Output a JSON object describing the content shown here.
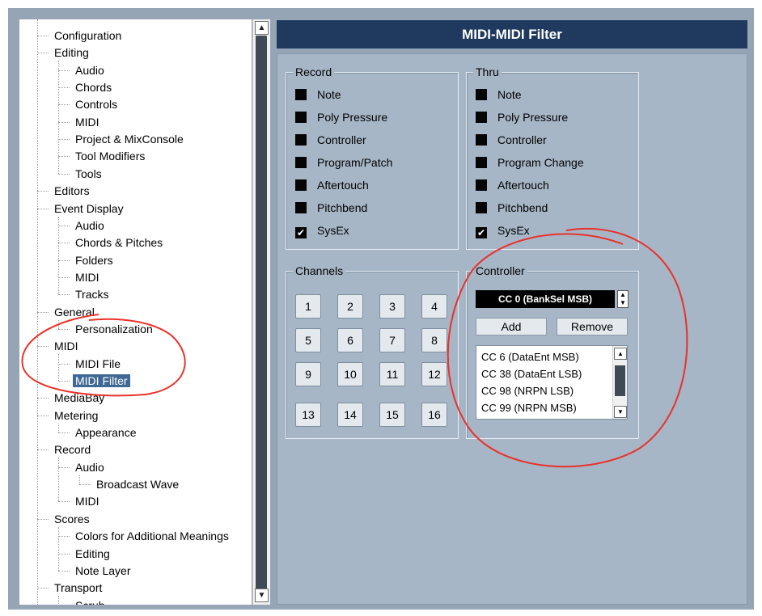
{
  "tree": {
    "items": [
      {
        "label": "Configuration",
        "level": 0
      },
      {
        "label": "Editing",
        "level": 0
      },
      {
        "label": "Audio",
        "level": 1
      },
      {
        "label": "Chords",
        "level": 1
      },
      {
        "label": "Controls",
        "level": 1
      },
      {
        "label": "MIDI",
        "level": 1
      },
      {
        "label": "Project & MixConsole",
        "level": 1
      },
      {
        "label": "Tool Modifiers",
        "level": 1
      },
      {
        "label": "Tools",
        "level": 1
      },
      {
        "label": "Editors",
        "level": 0
      },
      {
        "label": "Event Display",
        "level": 0
      },
      {
        "label": "Audio",
        "level": 1
      },
      {
        "label": "Chords & Pitches",
        "level": 1
      },
      {
        "label": "Folders",
        "level": 1
      },
      {
        "label": "MIDI",
        "level": 1
      },
      {
        "label": "Tracks",
        "level": 1
      },
      {
        "label": "General",
        "level": 0
      },
      {
        "label": "Personalization",
        "level": 1
      },
      {
        "label": "MIDI",
        "level": 0
      },
      {
        "label": "MIDI File",
        "level": 1
      },
      {
        "label": "MIDI Filter",
        "level": 1,
        "selected": true
      },
      {
        "label": "MediaBay",
        "level": 0
      },
      {
        "label": "Metering",
        "level": 0
      },
      {
        "label": "Appearance",
        "level": 1
      },
      {
        "label": "Record",
        "level": 0
      },
      {
        "label": "Audio",
        "level": 1
      },
      {
        "label": "Broadcast Wave",
        "level": 2
      },
      {
        "label": "MIDI",
        "level": 1
      },
      {
        "label": "Scores",
        "level": 0
      },
      {
        "label": "Colors for Additional Meanings",
        "level": 1
      },
      {
        "label": "Editing",
        "level": 1
      },
      {
        "label": "Note Layer",
        "level": 1
      },
      {
        "label": "Transport",
        "level": 0
      },
      {
        "label": "Scrub",
        "level": 1
      }
    ]
  },
  "panel": {
    "title": "MIDI-MIDI Filter",
    "record": {
      "title": "Record",
      "items": [
        {
          "label": "Note",
          "checked": false
        },
        {
          "label": "Poly Pressure",
          "checked": false
        },
        {
          "label": "Controller",
          "checked": false
        },
        {
          "label": "Program/Patch",
          "checked": false
        },
        {
          "label": "Aftertouch",
          "checked": false
        },
        {
          "label": "Pitchbend",
          "checked": false
        },
        {
          "label": "SysEx",
          "checked": true
        }
      ]
    },
    "thru": {
      "title": "Thru",
      "items": [
        {
          "label": "Note",
          "checked": false
        },
        {
          "label": "Poly Pressure",
          "checked": false
        },
        {
          "label": "Controller",
          "checked": false
        },
        {
          "label": "Program Change",
          "checked": false
        },
        {
          "label": "Aftertouch",
          "checked": false
        },
        {
          "label": "Pitchbend",
          "checked": false
        },
        {
          "label": "SysEx",
          "checked": true
        }
      ]
    },
    "channels": {
      "title": "Channels",
      "buttons": [
        "1",
        "2",
        "3",
        "4",
        "5",
        "6",
        "7",
        "8",
        "9",
        "10",
        "11",
        "12",
        "13",
        "14",
        "15",
        "16"
      ]
    },
    "controller": {
      "title": "Controller",
      "selected": "CC 0  (BankSel MSB)",
      "add_label": "Add",
      "remove_label": "Remove",
      "list": [
        "CC 6  (DataEnt MSB)",
        "CC 38  (DataEnt LSB)",
        "CC 98  (NRPN LSB)",
        "CC 99  (NRPN MSB)"
      ]
    }
  },
  "colors": {
    "title_bar": "#1f3a5e",
    "panel_bg": "#a7b6c6",
    "selection": "#3e6895",
    "annotation": "#e8322a"
  },
  "icons": {
    "scroll_up": "chevron-up-icon",
    "scroll_down": "chevron-down-icon",
    "check": "checkmark-icon"
  }
}
